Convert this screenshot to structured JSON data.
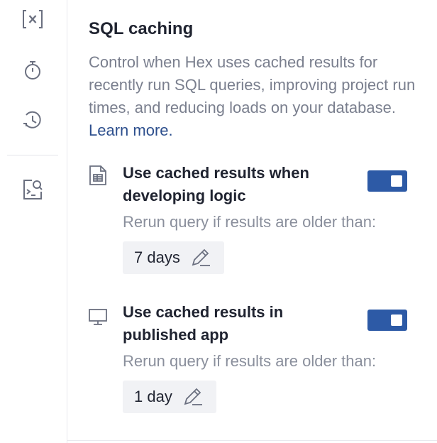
{
  "rail": {
    "icons": [
      "variables-icon",
      "timer-icon",
      "history-icon",
      "sql-search-icon"
    ]
  },
  "panel": {
    "title": "SQL caching",
    "description": "Control when Hex uses cached results for recently run SQL queries, improving project run times, and reducing loads on your database.",
    "learn_more": "Learn more."
  },
  "settings": [
    {
      "icon": "document-table-icon",
      "label": "Use cached results when developing logic",
      "enabled": true,
      "rerun_label": "Rerun query if results are older than:",
      "duration": "7 days"
    },
    {
      "icon": "monitor-icon",
      "label": "Use cached results in published app",
      "enabled": true,
      "rerun_label": "Rerun query if results are older than:",
      "duration": "1 day"
    }
  ],
  "colors": {
    "toggle_on": "#2d5aa6",
    "link": "#2d4f8d",
    "muted_text": "#7a7f8e"
  }
}
